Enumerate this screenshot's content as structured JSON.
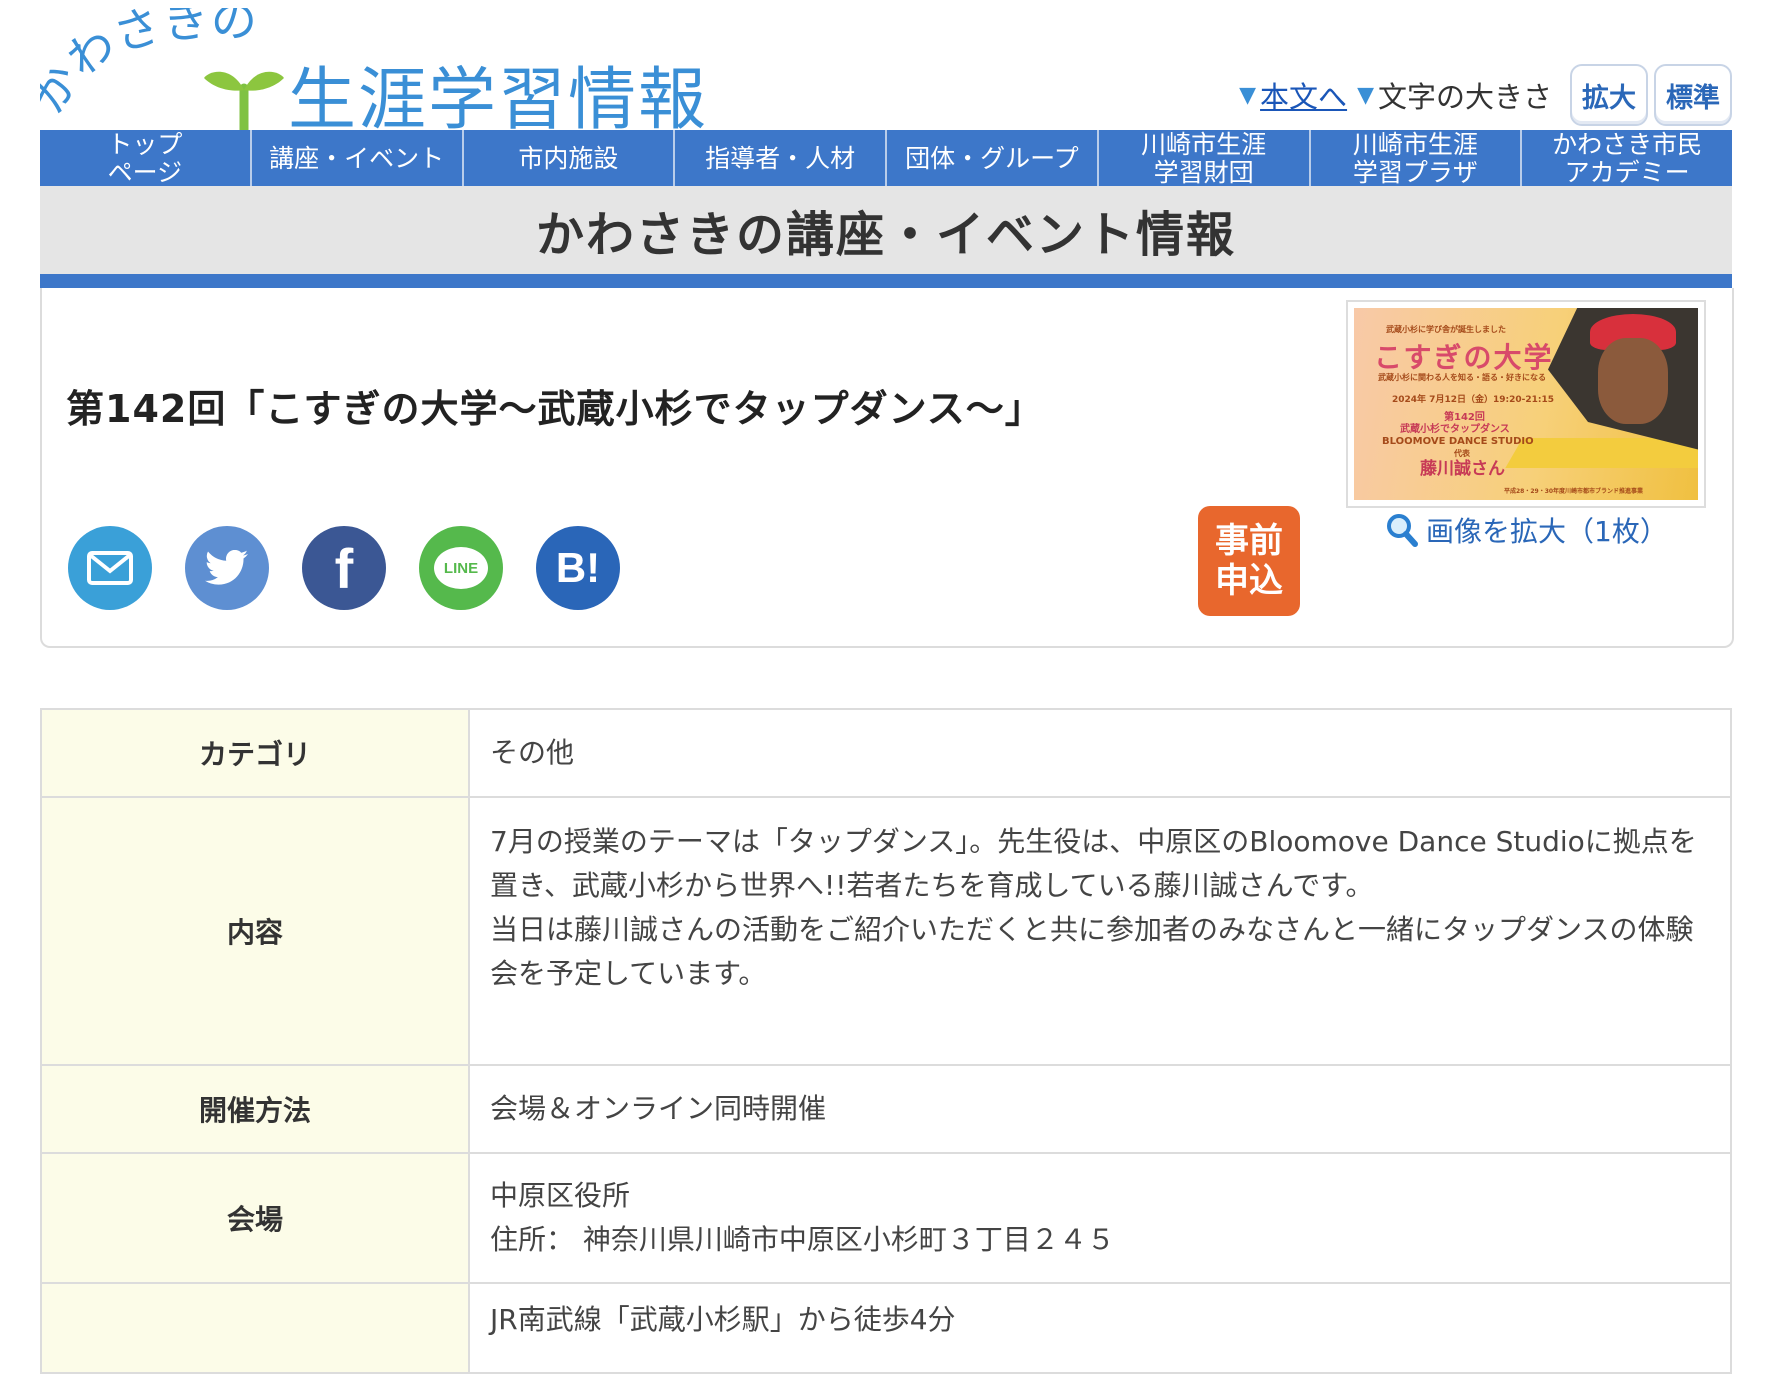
{
  "site": {
    "logo_arc": "かわさきの",
    "logo_title": "生涯学習情報"
  },
  "tools": {
    "skip_link": "本文へ",
    "text_size_label": "文字の大きさ",
    "enlarge": "拡大",
    "standard": "標準"
  },
  "nav": {
    "items": [
      "トップ\nページ",
      "講座・イベント",
      "市内施設",
      "指導者・人材",
      "団体・グループ",
      "川崎市生涯\n学習財団",
      "川崎市生涯\n学習プラザ",
      "かわさき市民\nアカデミー"
    ]
  },
  "page_title": "かわさきの講座・イベント情報",
  "event": {
    "title": "第142回「こすぎの大学～武蔵小杉でタップダンス～」",
    "apply_label": "事前\n申込",
    "zoom_label": "画像を拡大（1枚）",
    "share": [
      "mail-icon",
      "twitter-icon",
      "facebook-icon",
      "line-icon",
      "hatena-bookmark-icon"
    ],
    "share_text": {
      "facebook": "f",
      "line": "LINE",
      "hatena": "B!"
    },
    "poster": {
      "top": "武蔵小杉に学び舎が誕生しました",
      "main": "こすぎの大学",
      "sub": "武蔵小杉に関わる人を知る・語る・好きになる",
      "date": "2024年 7月12日（金）19:20-21:15",
      "session": "第142回",
      "theme": "武蔵小杉でタップダンス",
      "studio": "BLOOMOVE DANCE STUDIO",
      "role": "代表",
      "name": "藤川誠さん",
      "footer": "平成28・29・30年度川崎市都市ブランド推進事業"
    },
    "colors": {
      "apply": "#e8672d",
      "mail": "#3aa0d8",
      "twitter": "#5e8fd2",
      "facebook": "#3b5794",
      "line": "#55b94c",
      "hatena": "#2a66b8"
    }
  },
  "info": {
    "rows": [
      {
        "label": "カテゴリ",
        "value": "その他"
      },
      {
        "label": "内容",
        "value": "7月の授業のテーマは「タップダンス」。先生役は、中原区のBloomove Dance Studioに拠点を置き、武蔵小杉から世界へ!!若者たちを育成している藤川誠さんです。\n当日は藤川誠さんの活動をご紹介いただくと共に参加者のみなさんと一緒にタップダンスの体験会を予定しています。"
      },
      {
        "label": "開催方法",
        "value": "会場＆オンライン同時開催"
      },
      {
        "label": "会場",
        "value": "中原区役所\n住所： 神奈川県川崎市中原区小杉町３丁目２４５"
      },
      {
        "label": "",
        "value": "JR南武線「武蔵小杉駅」から徒歩4分"
      }
    ]
  }
}
